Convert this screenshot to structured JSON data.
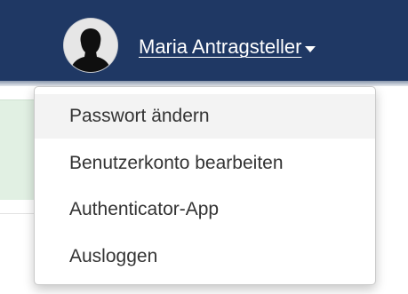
{
  "header": {
    "user_name": "Maria Antragsteller",
    "avatar_icon": "user-silhouette-icon",
    "dropdown_icon": "caret-down-icon",
    "background_color": "#1f3864"
  },
  "user_menu": {
    "items": [
      {
        "label": "Passwort ändern",
        "state": "hovered"
      },
      {
        "label": "Benutzerkonto bearbeiten"
      },
      {
        "label": "Authenticator-App"
      },
      {
        "label": "Ausloggen"
      }
    ]
  },
  "colors": {
    "menu_text": "#333333",
    "hover_background": "#f3f3f3",
    "page_strip": "#e1f0e3"
  }
}
